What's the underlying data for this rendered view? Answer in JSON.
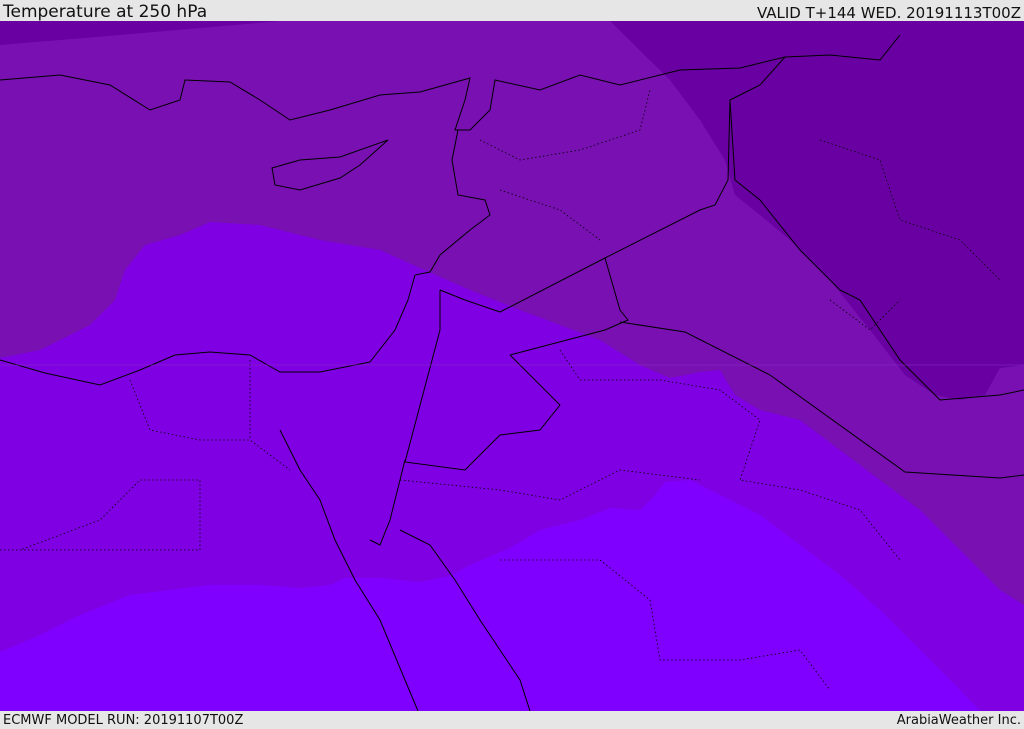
{
  "header": {
    "title": "Temperature at 250 hPa",
    "valid": "VALID T+144 WED. 20191113T00Z"
  },
  "footer": {
    "model_run": "ECMWF MODEL RUN: 20191107T00Z",
    "credit": "ArabiaWeather Inc."
  },
  "colors": {
    "coldest": "#6800a2",
    "cold": "#7810b2",
    "mid": "#7f00e2",
    "warm": "#7f00ff",
    "background": "#e6e6e6",
    "borders": "#000000"
  }
}
